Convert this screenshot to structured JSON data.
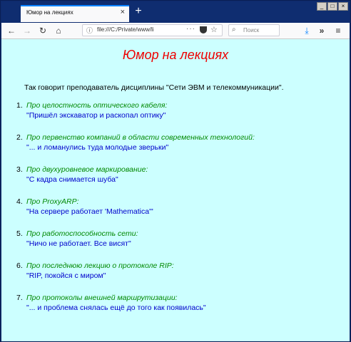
{
  "browser": {
    "tab_title": "Юмор на лекциях",
    "tab_close": "×",
    "new_tab": "+",
    "window_buttons": [
      "_",
      "□",
      "×"
    ],
    "url": "file:///C:/Private/www/li",
    "search_placeholder": "Поиск"
  },
  "page": {
    "title": "Юмор на лекциях",
    "intro": "Так говорит преподаватель дисциплины \"Сети ЭВМ и телекоммуникации\".",
    "items": [
      {
        "num": "1.",
        "topic": "Про целостность оптического кабеля:",
        "quote": "\"Пришёл экскаватор и раскопал оптику\""
      },
      {
        "num": "2.",
        "topic": "Про первенство компаний в области современных технологий:",
        "quote": "\"... и ломанулись туда молодые зверьки\""
      },
      {
        "num": "3.",
        "topic": "Про двухуровневое маркирование:",
        "quote": "\"С кадра снимается шуба\""
      },
      {
        "num": "4.",
        "topic": "Про ProxyARP:",
        "quote": "\"На сервере работает 'Mathematica'\""
      },
      {
        "num": "5.",
        "topic": "Про работоспособность сети:",
        "quote": "\"Ничо не работает. Все висят\""
      },
      {
        "num": "6.",
        "topic": "Про последнюю лекцию о протоколе RIP:",
        "quote": "\"RIP, покойся с миром\""
      },
      {
        "num": "7.",
        "topic": "Про протоколы внешней маршрутизации:",
        "quote": "\"... и проблема снялась ещё до того как появилась\""
      }
    ]
  },
  "colors": {
    "title": "#ee0000",
    "topic": "#008800",
    "quote": "#0000cc",
    "background": "#ccffff"
  }
}
